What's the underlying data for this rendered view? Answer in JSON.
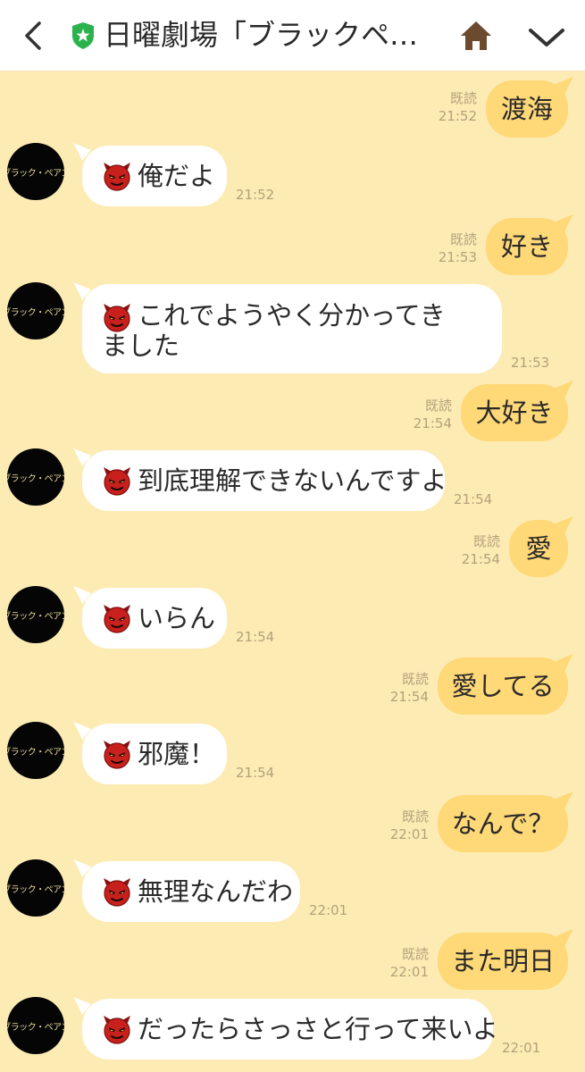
{
  "header": {
    "title": "日曜劇場「ブラックペ…",
    "back_icon": "chevron-left-icon",
    "shield_icon": "shield-star-icon",
    "home_icon": "home-icon",
    "menu_icon": "chevron-down-icon"
  },
  "colors": {
    "background": "#fdebb4",
    "outgoing_bubble": "#ffd877",
    "incoming_bubble": "#ffffff",
    "shield": "#2bb24c",
    "home": "#6b4a2e"
  },
  "avatar_label": "ブラック・ペアン",
  "messages": [
    {
      "dir": "out",
      "text": "渡海",
      "read": "既読",
      "time": "21:52"
    },
    {
      "dir": "in",
      "text": "俺だよ",
      "time": "21:52"
    },
    {
      "dir": "out",
      "text": "好き",
      "read": "既読",
      "time": "21:53"
    },
    {
      "dir": "in",
      "text": "これでようやく分かってきました",
      "time": "21:53"
    },
    {
      "dir": "out",
      "text": "大好き",
      "read": "既読",
      "time": "21:54"
    },
    {
      "dir": "in",
      "text": "到底理解できないんですよ",
      "time": "21:54"
    },
    {
      "dir": "out",
      "text": "愛",
      "read": "既読",
      "time": "21:54"
    },
    {
      "dir": "in",
      "text": "いらん",
      "time": "21:54"
    },
    {
      "dir": "out",
      "text": "愛してる",
      "read": "既読",
      "time": "21:54"
    },
    {
      "dir": "in",
      "text": "邪魔！",
      "time": "21:54"
    },
    {
      "dir": "out",
      "text": "なんで？",
      "read": "既読",
      "time": "22:01"
    },
    {
      "dir": "in",
      "text": "無理なんだわ",
      "time": "22:01"
    },
    {
      "dir": "out",
      "text": "また明日",
      "read": "既読",
      "time": "22:01"
    },
    {
      "dir": "in",
      "text": "だったらさっさと行って来いよ",
      "time": "22:01"
    }
  ]
}
